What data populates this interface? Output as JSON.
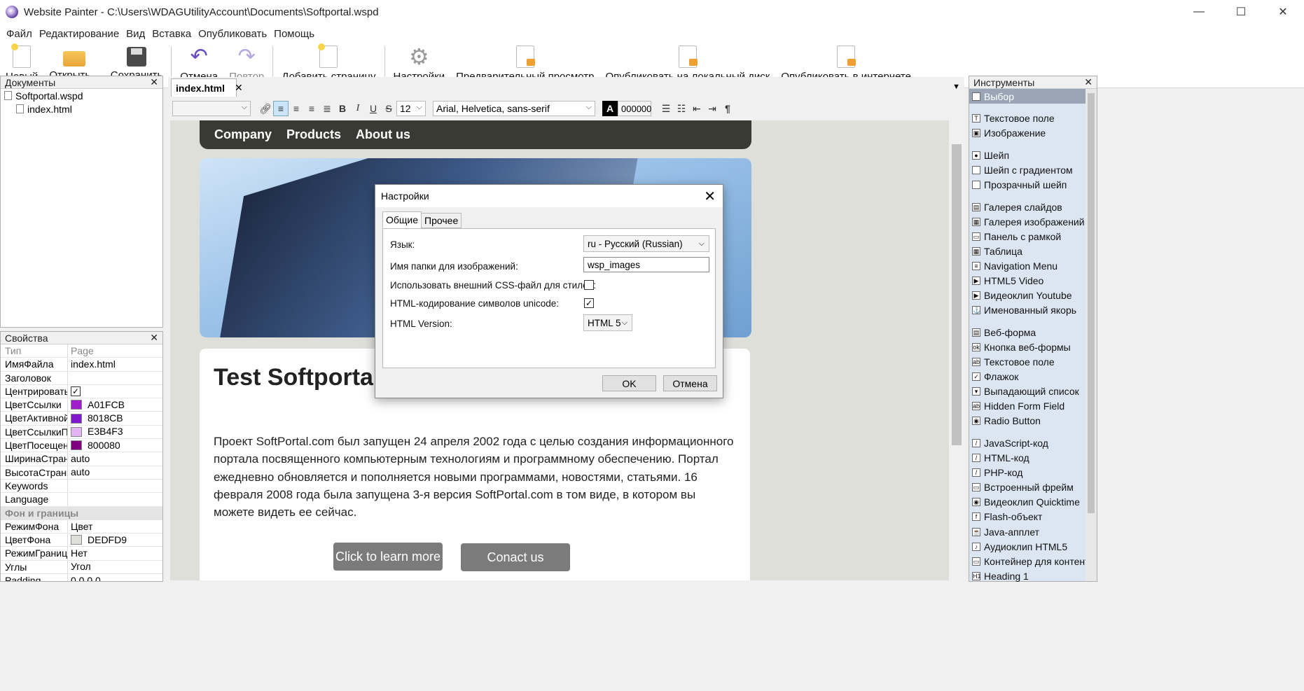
{
  "window": {
    "title": "Website Painter - C:\\Users\\WDAGUtilityAccount\\Documents\\Softportal.wspd",
    "minimize": "—",
    "maximize": "☐",
    "close": "✕"
  },
  "menu": [
    "Файл",
    "Редактирование",
    "Вид",
    "Вставка",
    "Опубликовать",
    "Помощь"
  ],
  "toolbar": {
    "new": "Новый",
    "open": "Открыть...",
    "save": "Сохранить",
    "undo": "Отмена",
    "redo": "Повтор",
    "add_page": "Добавить страницу",
    "settings": "Настройки",
    "preview": "Предварительный просмотр",
    "publish_local": "Опубликовать на локальный диск",
    "publish_web": "Опубликовать в интернете"
  },
  "documents": {
    "title": "Документы",
    "close": "✕",
    "project": "Softportal.wspd",
    "page": "index.html"
  },
  "properties": {
    "title": "Свойства",
    "close": "✕",
    "header": {
      "k": "Тип",
      "v": "Page"
    },
    "rows": [
      {
        "k": "ИмяФайла",
        "v": "index.html"
      },
      {
        "k": "Заголовок",
        "v": ""
      },
      {
        "k": "ЦентрироватьС",
        "v": "",
        "check": "✓"
      },
      {
        "k": "ЦветСсылки",
        "v": "A01FCB",
        "color": "#A01FCB"
      },
      {
        "k": "ЦветАктивнойС",
        "v": "8018CB",
        "color": "#8018CB"
      },
      {
        "k": "ЦветСсылкиПр",
        "v": "E3B4F3",
        "color": "#E3B4F3"
      },
      {
        "k": "ЦветПосещенн",
        "v": "800080",
        "color": "#800080"
      },
      {
        "k": "ШиринаСтрани",
        "v": "auto"
      },
      {
        "k": "ВысотаСтрани",
        "v": "auto"
      },
      {
        "k": "Keywords",
        "v": ""
      },
      {
        "k": "Language",
        "v": ""
      }
    ],
    "section": "Фон и границы",
    "rows2": [
      {
        "k": "РежимФона",
        "v": "Цвет"
      },
      {
        "k": "ЦветФона",
        "v": "DEDFD9",
        "color": "#DEDFD9"
      },
      {
        "k": "РежимГраниц",
        "v": "Нет"
      },
      {
        "k": "Углы",
        "v": "Угол"
      },
      {
        "k": "Padding",
        "v": "0,0,0,0"
      }
    ]
  },
  "tab": {
    "label": "index.html",
    "close": "✕"
  },
  "format": {
    "font_size": "12",
    "font_family": "Arial, Helvetica, sans-serif",
    "color_label": "A",
    "color_value": "000000",
    "bold": "B",
    "italic": "I",
    "underline": "U",
    "strike": "S",
    "pilcrow": "¶"
  },
  "page": {
    "nav": [
      "Company",
      "Products",
      "About us"
    ],
    "heading": "Test Softportal",
    "paragraph": "Проект SoftPortal.com был запущен 24 апреля 2002 года с целью создания информационного портала посвященного компьютерным технологиям и программному обеспечению. Портал ежедневно обновляется и пополняется новыми программами, новостями, статьями. 16 февраля 2008 года была запущена 3-я версия SoftPortal.com в том виде, в котором вы можете видеть ее сейчас.",
    "btn_learn": "Click to learn more",
    "btn_contact": "Conact us"
  },
  "dialog": {
    "title": "Настройки",
    "close": "✕",
    "tabs": [
      "Общие",
      "Прочее"
    ],
    "lang_label": "Язык:",
    "lang_value": "ru - Русский (Russian)",
    "folder_label": "Имя папки для изображений:",
    "folder_value": "wsp_images",
    "css_label": "Использовать внешний CSS-файл для стилей:",
    "unicode_label": "HTML-кодирование символов unicode:",
    "unicode_check": "✓",
    "version_label": "HTML Version:",
    "version_value": "HTML 5",
    "ok": "OK",
    "cancel": "Отмена"
  },
  "tools": {
    "title": "Инструменты",
    "close": "✕",
    "items": [
      {
        "label": "Выбор",
        "icon": "pointer-icon",
        "g": "➤",
        "sel": true
      },
      {
        "sp": true
      },
      {
        "label": "Текстовое поле",
        "icon": "text-icon",
        "g": "T"
      },
      {
        "label": "Изображение",
        "icon": "image-icon",
        "g": "▣"
      },
      {
        "sp": true
      },
      {
        "label": "Шейп",
        "icon": "shape-icon",
        "g": "●"
      },
      {
        "label": "Шейп с градиентом",
        "icon": "gradient-shape-icon",
        "g": ""
      },
      {
        "label": "Прозрачный шейп",
        "icon": "transparent-shape-icon",
        "g": ""
      },
      {
        "sp": true
      },
      {
        "label": "Галерея слайдов",
        "icon": "slideshow-icon",
        "g": "▤"
      },
      {
        "label": "Галерея изображений",
        "icon": "gallery-icon",
        "g": "▦"
      },
      {
        "label": "Панель с рамкой",
        "icon": "panel-icon",
        "g": "▭"
      },
      {
        "label": "Таблица",
        "icon": "table-icon",
        "g": "▦"
      },
      {
        "label": "Navigation Menu",
        "icon": "menu-icon",
        "g": "≡"
      },
      {
        "label": "HTML5 Video",
        "icon": "video-icon",
        "g": "▶"
      },
      {
        "label": "Видеоклип Youtube",
        "icon": "youtube-icon",
        "g": "▶"
      },
      {
        "label": "Именованный якорь",
        "icon": "anchor-icon",
        "g": "⚓"
      },
      {
        "sp": true
      },
      {
        "label": "Веб-форма",
        "icon": "form-icon",
        "g": "▤"
      },
      {
        "label": "Кнопка веб-формы",
        "icon": "form-button-icon",
        "g": "ok"
      },
      {
        "label": "Текстовое поле",
        "icon": "textfield-icon",
        "g": "ab"
      },
      {
        "label": "Флажок",
        "icon": "checkbox-icon",
        "g": "✓"
      },
      {
        "label": "Выпадающий список",
        "icon": "dropdown-icon",
        "g": "▾"
      },
      {
        "label": "Hidden Form Field",
        "icon": "hidden-field-icon",
        "g": "ab"
      },
      {
        "label": "Radio Button",
        "icon": "radio-icon",
        "g": "◉"
      },
      {
        "sp": true
      },
      {
        "label": "JavaScript-код",
        "icon": "js-icon",
        "g": "/"
      },
      {
        "label": "HTML-код",
        "icon": "html-icon",
        "g": "/"
      },
      {
        "label": "PHP-код",
        "icon": "php-icon",
        "g": "/"
      },
      {
        "label": "Встроенный фрейм",
        "icon": "iframe-icon",
        "g": "▭"
      },
      {
        "label": "Видеоклип Quicktime",
        "icon": "quicktime-icon",
        "g": "◉"
      },
      {
        "label": "Flash-объект",
        "icon": "flash-icon",
        "g": "f"
      },
      {
        "label": "Java-апплет",
        "icon": "java-icon",
        "g": "☕"
      },
      {
        "label": "Аудиоклип HTML5",
        "icon": "audio-icon",
        "g": "♪"
      },
      {
        "label": "Контейнер для контента",
        "icon": "container-icon",
        "g": "▭"
      },
      {
        "label": "Heading 1",
        "icon": "heading-icon",
        "g": "H1"
      }
    ]
  }
}
